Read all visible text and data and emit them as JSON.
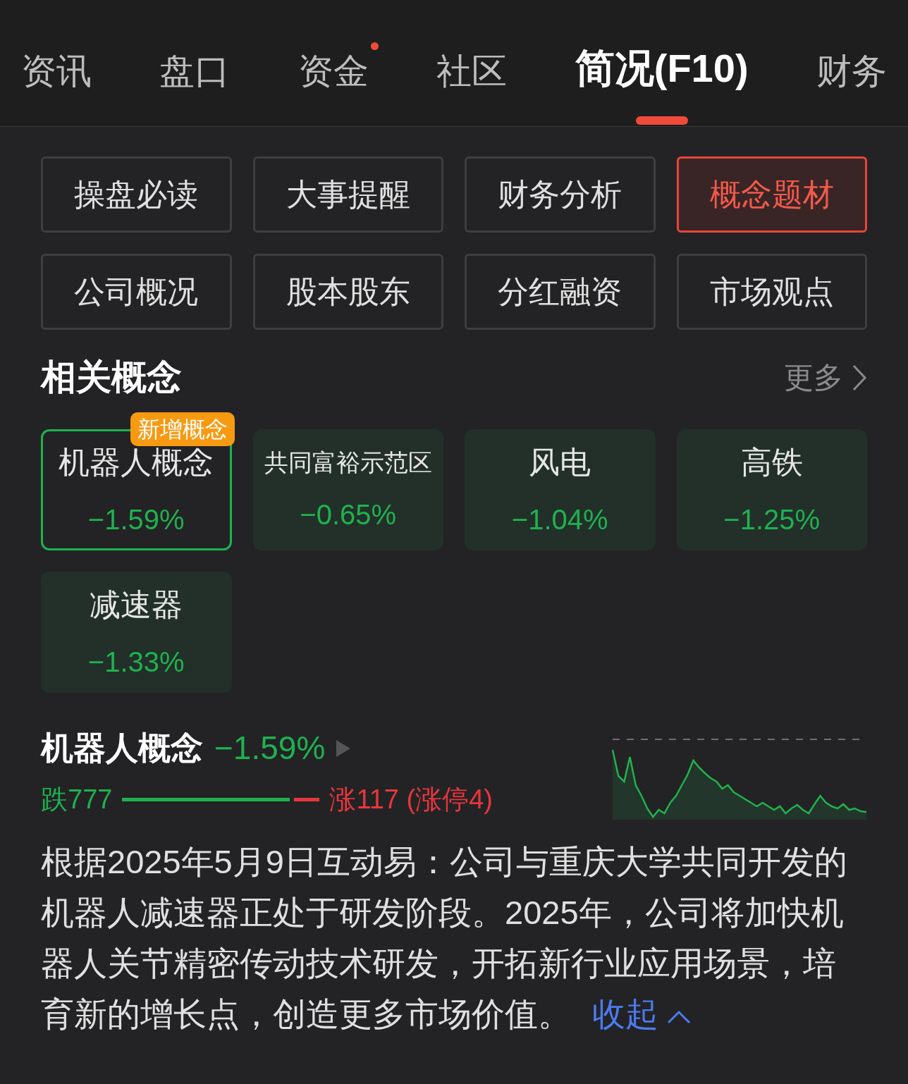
{
  "tabs": [
    {
      "label": "资讯",
      "selected": false,
      "dot": false
    },
    {
      "label": "盘口",
      "selected": false,
      "dot": false
    },
    {
      "label": "资金",
      "selected": false,
      "dot": true
    },
    {
      "label": "社区",
      "selected": false,
      "dot": false
    },
    {
      "label": "简况(F10)",
      "selected": true,
      "dot": false
    },
    {
      "label": "财务",
      "selected": false,
      "dot": false
    }
  ],
  "sections": [
    {
      "label": "操盘必读",
      "selected": false
    },
    {
      "label": "大事提醒",
      "selected": false
    },
    {
      "label": "财务分析",
      "selected": false
    },
    {
      "label": "概念题材",
      "selected": true
    },
    {
      "label": "公司概况",
      "selected": false
    },
    {
      "label": "股本股东",
      "selected": false
    },
    {
      "label": "分红融资",
      "selected": false
    },
    {
      "label": "市场观点",
      "selected": false
    }
  ],
  "related": {
    "title": "相关概念",
    "more": "更多",
    "concepts": [
      {
        "name": "机器人概念",
        "change": "−1.59%",
        "selected": true,
        "badge": "新增概念"
      },
      {
        "name": "共同富裕示范区",
        "change": "−0.65%",
        "selected": false
      },
      {
        "name": "风电",
        "change": "−1.04%",
        "selected": false
      },
      {
        "name": "高铁",
        "change": "−1.25%",
        "selected": false
      },
      {
        "name": "减速器",
        "change": "−1.33%",
        "selected": false
      }
    ]
  },
  "detail": {
    "name": "机器人概念",
    "change": "−1.59%",
    "fall": "跌777",
    "rise": "涨117 (涨停4)",
    "level": 0.87,
    "text": "根据2025年5月9日互动易：公司与重庆大学共同开发的机器人减速器正处于研发阶段。2025年，公司将加快机器人关节精密传动技术研发，开拓新行业应用场景，培育新的增长点，创造更多市场价值。",
    "collapse": "收起"
  }
}
